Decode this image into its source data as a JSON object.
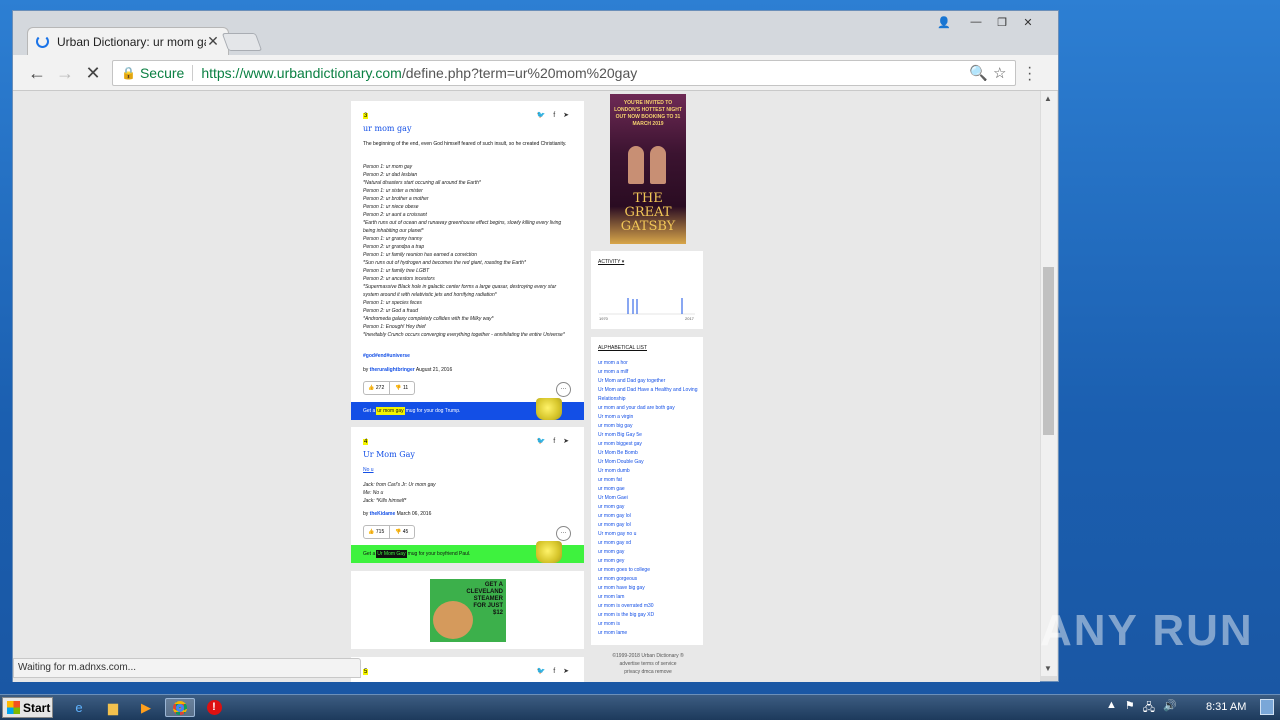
{
  "browser": {
    "tab_title": "Urban Dictionary: ur mom gay",
    "address_secure": "Secure",
    "url_host": "https://www.urbandictionary.com",
    "url_path": "/define.php?term=ur%20mom%20gay",
    "status_text": "Waiting for m.adnxs.com..."
  },
  "entry1": {
    "number": "3",
    "word": "ur mom gay",
    "meaning": "The beginning of the end, even God himself feared of such insult, so he created Christianity.",
    "example_lines": [
      "Person 1: ur mom gay",
      "Person 2: ur dad lesbian",
      "*Natural disasters start occuring all around the Earth*",
      "Person 1: ur sister a mister",
      "Person 2: ur brother a mother",
      "Person 1: ur niece obese",
      "Person 2: ur aunt a croissant",
      "*Earth runs out of ocean and runaway greenhouse effect begins, slowly killing every living being inhabiting our planet*",
      "Person 1: ur granny tranny",
      "Person 2: ur grandpa a trap",
      "Person 1: ur family reunion has earned a conviction",
      "*Sun runs out of hydrogen and becomes the red giant, roasting the Earth*",
      "Person 1: ur family tree LGBT",
      "Person 2: ur ancestors incestors",
      "*Supermassive Black hole in galactic center forms a large quasar, destroying every star system around it with relativistic jets and horrifying radiation*",
      "Person 1: ur species feces",
      "Person 2: ur God a fraud",
      "*Andromeda galaxy completely collides with the Milky way*",
      "Person 1: Enough! Hey thief",
      "*Inevitably Crunch occurs converging everything together - annihilating the entire Universe*"
    ],
    "tags": "#god#end#universe",
    "author": "theruralightbringer",
    "date": "August 21, 2016",
    "up": "272",
    "down": "11",
    "mug_prefix": "Get a",
    "mug_word": "ur mom gay",
    "mug_suffix": "mug for your dog Trump.",
    "mug_color": "#134fe6"
  },
  "entry2": {
    "number": "4",
    "word": "Ur Mom Gay",
    "meaning": "No u",
    "example_lines": [
      "Jack: from Carl's Jr: Ur mom gay",
      "Me: No u",
      "Jack: *Kills himself*"
    ],
    "author": "theKidame",
    "date": "March 06, 2016",
    "up": "715",
    "down": "45",
    "mug_prefix": "Get a",
    "mug_word": "Ur Mom Gay",
    "mug_suffix": "mug for your boyfriend Paul.",
    "mug_color": "#3ef23e"
  },
  "ad": {
    "text": "GET A CLEVELAND STEAMER FOR JUST $12"
  },
  "entry3": {
    "number": "5"
  },
  "sidebar": {
    "banner_top": "YOU'RE INVITED TO LONDON'S HOTTEST NIGHT OUT NOW BOOKING TO 31 MARCH 2019",
    "banner_title": "THE GREAT GATSBY",
    "activity_label": "ACTIVITY",
    "activity_axis_start": "1970",
    "activity_axis_end": "2017",
    "alpha_label": "ALPHABETICAL LIST",
    "alpha_items": [
      "ur mom a hor",
      "ur mom a milf",
      "Ur Mom and Dad gay together",
      "Ur Mom and Dad Have a Healthy and Loving Relationship",
      "ur mom and your dad are both gay",
      "Ur mom a virgin",
      "ur mom big gay",
      "Ur mom Big Gay 5e",
      "ur mom biggest gay",
      "Ur Mom Be Bomb",
      "Ur Mom Double Gay",
      "Ur mom dumb",
      "ur mom fat",
      "ur mom gae",
      "Ur Mom Gaei",
      "ur mom gay",
      "ur mom gay lol",
      "ur mom gay lol",
      "Ur mom gay no u",
      "ur mom gay xd",
      "ur mom gay",
      "ur mom gey",
      "ur mom goes to college",
      "ur mom gorgeous",
      "ur mom have big gay",
      "ur mom lam",
      "ur mom is overrated m30",
      "ur mom is the big gay XD",
      "ur mom is",
      "ur mom lame"
    ],
    "footer_lines": [
      "©1999-2018 Urban Dictionary ®",
      "advertise terms of service",
      "privacy dmca remove"
    ]
  },
  "taskbar": {
    "start_label": "Start",
    "clock": "8:31 AM"
  },
  "watermark": "ANY RUN"
}
